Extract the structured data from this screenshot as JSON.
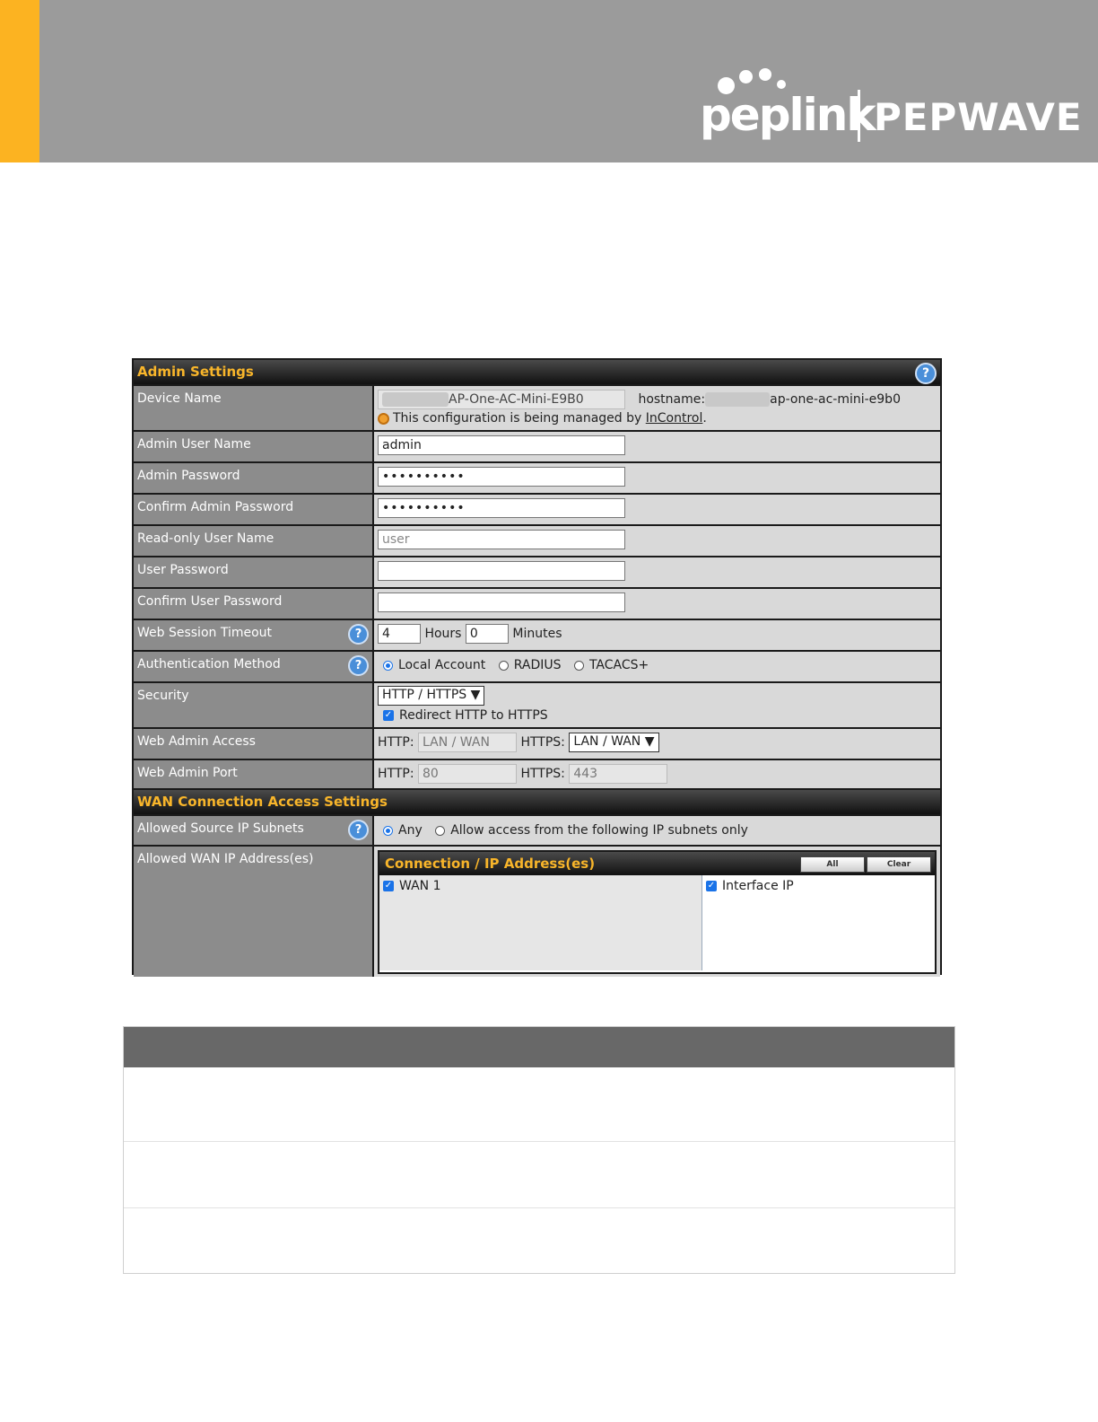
{
  "brand": {
    "wordmark": "peplink",
    "product": "PEPWAVE",
    "accent_color": "#fcb321",
    "banner_color": "#9b9b9b"
  },
  "admin_settings": {
    "title": "Admin Settings",
    "help_icon": "question-icon",
    "rows": {
      "device_name": {
        "label": "Device Name",
        "value": "AP-One-AC-Mini-E9B0",
        "hostname_label": "hostname:",
        "hostname_value": "ap-one-ac-mini-e9b0",
        "managed_note": "This configuration is being managed by",
        "managed_link": "InControl",
        "managed_end": "."
      },
      "admin_user": {
        "label": "Admin User Name",
        "value": "admin"
      },
      "admin_password": {
        "label": "Admin Password",
        "value": "••••••••••"
      },
      "confirm_admin_password": {
        "label": "Confirm Admin Password",
        "value": "••••••••••"
      },
      "readonly_user": {
        "label": "Read-only User Name",
        "placeholder": "user"
      },
      "user_password": {
        "label": "User Password",
        "value": ""
      },
      "confirm_user_password": {
        "label": "Confirm User Password",
        "value": ""
      },
      "session_timeout": {
        "label": "Web Session Timeout",
        "hours_value": "4",
        "hours_label": "Hours",
        "minutes_value": "0",
        "minutes_label": "Minutes"
      },
      "auth_method": {
        "label": "Authentication Method",
        "options": [
          "Local Account",
          "RADIUS",
          "TACACS+"
        ],
        "selected": "Local Account"
      },
      "security": {
        "label": "Security",
        "selected": "HTTP / HTTPS",
        "redirect_label": "Redirect HTTP to HTTPS",
        "redirect_checked": true
      },
      "web_admin_access": {
        "label": "Web Admin Access",
        "http_label": "HTTP:",
        "http_value": "LAN / WAN",
        "https_label": "HTTPS:",
        "https_value": "LAN / WAN"
      },
      "web_admin_port": {
        "label": "Web Admin Port",
        "http_label": "HTTP:",
        "http_value": "80",
        "https_label": "HTTPS:",
        "https_value": "443"
      }
    }
  },
  "wan_settings": {
    "title": "WAN Connection Access Settings",
    "allowed_subnets": {
      "label": "Allowed Source IP Subnets",
      "options": [
        "Any",
        "Allow access from the following IP subnets only"
      ],
      "selected": "Any"
    },
    "allowed_wan": {
      "label": "Allowed WAN IP Address(es)",
      "table_title": "Connection / IP Address(es)",
      "btn_all": "All",
      "btn_clear": "Clear",
      "connection": "WAN 1",
      "address": "Interface IP"
    }
  }
}
